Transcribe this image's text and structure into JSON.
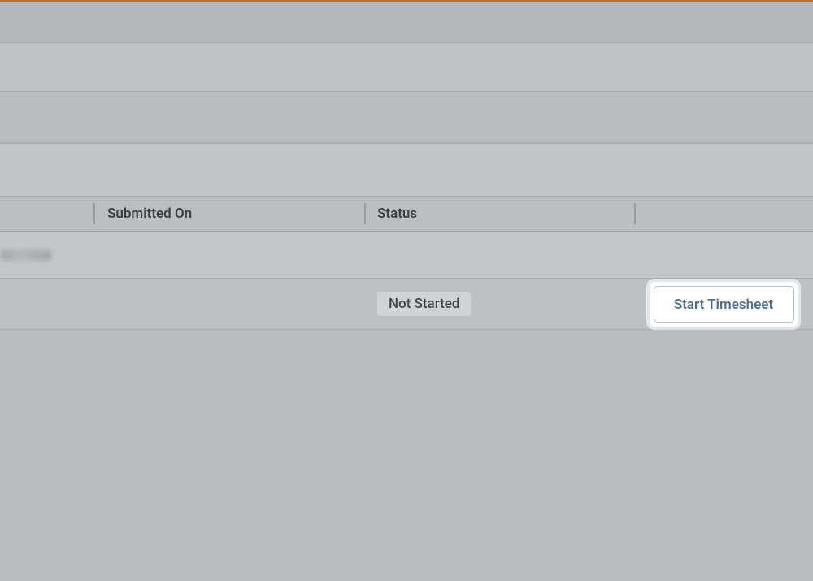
{
  "table": {
    "columns": {
      "submitted_on": "Submitted On",
      "status": "Status"
    },
    "rows": [
      {
        "submitted_on": "",
        "status": "Not Started",
        "action_label": "Start Timesheet"
      }
    ]
  }
}
